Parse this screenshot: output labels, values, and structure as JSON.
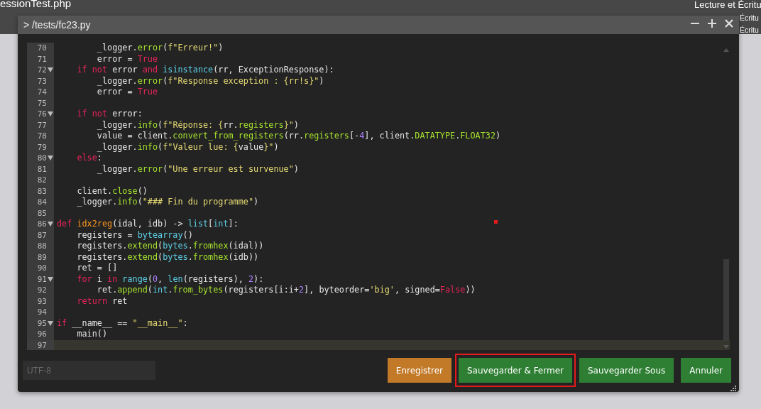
{
  "background": {
    "file_name": "essionTest.php",
    "right_texts": [
      "Lecture et Écritu",
      "Écritu",
      "Écritu"
    ]
  },
  "window": {
    "title": "> /tests/fc23.py",
    "controls": [
      {
        "kind": "minimize"
      },
      {
        "kind": "maximize"
      },
      {
        "kind": "close"
      }
    ]
  },
  "editor": {
    "lines": [
      {
        "number": "70",
        "current": false,
        "tokens": [
          {
            "text": "        _logger.",
            "kind": "plain"
          },
          {
            "text": "error",
            "kind": "call"
          },
          {
            "text": "(",
            "kind": "plain"
          },
          {
            "text": "f\"Erreur!\"",
            "kind": "string"
          },
          {
            "text": ")",
            "kind": "plain"
          }
        ]
      },
      {
        "number": "71",
        "current": false,
        "tokens": [
          {
            "text": "        error = ",
            "kind": "plain"
          },
          {
            "text": "True",
            "kind": "keyword"
          }
        ]
      },
      {
        "number": "72",
        "current": false,
        "expanded": true,
        "tokens": [
          {
            "text": "    if",
            "kind": "keyword"
          },
          {
            "text": " not",
            "kind": "keyword"
          },
          {
            "text": " error ",
            "kind": "plain"
          },
          {
            "text": "and",
            "kind": "keyword"
          },
          {
            "text": " isinstance",
            "kind": "builtin"
          },
          {
            "text": "(rr, ExceptionResponse):",
            "kind": "plain"
          }
        ]
      },
      {
        "number": "73",
        "current": false,
        "tokens": [
          {
            "text": "        _logger.",
            "kind": "plain"
          },
          {
            "text": "error",
            "kind": "call"
          },
          {
            "text": "(",
            "kind": "plain"
          },
          {
            "text": "f\"Response exception : {rr!s}\"",
            "kind": "string"
          },
          {
            "text": ")",
            "kind": "plain"
          }
        ]
      },
      {
        "number": "74",
        "current": false,
        "tokens": [
          {
            "text": "        error = ",
            "kind": "plain"
          },
          {
            "text": "True",
            "kind": "keyword"
          }
        ]
      },
      {
        "number": "75",
        "current": false
      },
      {
        "number": "76",
        "current": false,
        "expanded": true,
        "tokens": [
          {
            "text": "    if",
            "kind": "keyword"
          },
          {
            "text": " not",
            "kind": "keyword"
          },
          {
            "text": " error:",
            "kind": "plain"
          }
        ]
      },
      {
        "number": "77",
        "current": false,
        "tokens": [
          {
            "text": "        _logger.",
            "kind": "plain"
          },
          {
            "text": "info",
            "kind": "call"
          },
          {
            "text": "(",
            "kind": "plain"
          },
          {
            "text": "f\"Réponse: {",
            "kind": "string"
          },
          {
            "text": "rr.",
            "kind": "plain"
          },
          {
            "text": "registers",
            "kind": "call"
          },
          {
            "text": "}\"",
            "kind": "string"
          },
          {
            "text": ")",
            "kind": "plain"
          }
        ]
      },
      {
        "number": "78",
        "current": false,
        "tokens": [
          {
            "text": "        value = client.",
            "kind": "plain"
          },
          {
            "text": "convert_from_registers",
            "kind": "call"
          },
          {
            "text": "(rr.",
            "kind": "plain"
          },
          {
            "text": "registers",
            "kind": "call"
          },
          {
            "text": "[-",
            "kind": "plain"
          },
          {
            "text": "4",
            "kind": "number"
          },
          {
            "text": "], client.",
            "kind": "plain"
          },
          {
            "text": "DATATYPE",
            "kind": "call"
          },
          {
            "text": ".",
            "kind": "plain"
          },
          {
            "text": "FLOAT32",
            "kind": "call"
          },
          {
            "text": ")",
            "kind": "plain"
          }
        ]
      },
      {
        "number": "79",
        "current": false,
        "tokens": [
          {
            "text": "        _logger.",
            "kind": "plain"
          },
          {
            "text": "info",
            "kind": "call"
          },
          {
            "text": "(",
            "kind": "plain"
          },
          {
            "text": "f\"Valeur lue: {",
            "kind": "string"
          },
          {
            "text": "value",
            "kind": "plain"
          },
          {
            "text": "}\"",
            "kind": "string"
          },
          {
            "text": ")",
            "kind": "plain"
          }
        ]
      },
      {
        "number": "80",
        "current": false,
        "expanded": true,
        "tokens": [
          {
            "text": "    else",
            "kind": "keyword"
          },
          {
            "text": ":",
            "kind": "plain"
          }
        ]
      },
      {
        "number": "81",
        "current": false,
        "tokens": [
          {
            "text": "        _logger.",
            "kind": "plain"
          },
          {
            "text": "error",
            "kind": "call"
          },
          {
            "text": "(",
            "kind": "plain"
          },
          {
            "text": "\"Une erreur est survenue\"",
            "kind": "string"
          },
          {
            "text": ")",
            "kind": "plain"
          }
        ]
      },
      {
        "number": "82",
        "current": false
      },
      {
        "number": "83",
        "current": false,
        "tokens": [
          {
            "text": "    client.",
            "kind": "plain"
          },
          {
            "text": "close",
            "kind": "call"
          },
          {
            "text": "()",
            "kind": "plain"
          }
        ]
      },
      {
        "number": "84",
        "current": false,
        "tokens": [
          {
            "text": "    _logger.",
            "kind": "plain"
          },
          {
            "text": "info",
            "kind": "call"
          },
          {
            "text": "(",
            "kind": "plain"
          },
          {
            "text": "\"### Fin du programme\"",
            "kind": "string"
          },
          {
            "text": ")",
            "kind": "plain"
          }
        ]
      },
      {
        "number": "85",
        "current": false
      },
      {
        "number": "86",
        "current": false,
        "expanded": true,
        "tokens": [
          {
            "text": "def",
            "kind": "keyword"
          },
          {
            "text": " idx2reg",
            "kind": "funcname"
          },
          {
            "text": "(idal, idb) -> ",
            "kind": "plain"
          },
          {
            "text": "list",
            "kind": "builtin"
          },
          {
            "text": "[",
            "kind": "plain"
          },
          {
            "text": "int",
            "kind": "builtin"
          },
          {
            "text": "]:",
            "kind": "plain"
          }
        ]
      },
      {
        "number": "87",
        "current": false,
        "tokens": [
          {
            "text": "    registers = ",
            "kind": "plain"
          },
          {
            "text": "bytearray",
            "kind": "builtin"
          },
          {
            "text": "()",
            "kind": "plain"
          }
        ]
      },
      {
        "number": "88",
        "current": false,
        "tokens": [
          {
            "text": "    registers.",
            "kind": "plain"
          },
          {
            "text": "extend",
            "kind": "call"
          },
          {
            "text": "(",
            "kind": "plain"
          },
          {
            "text": "bytes",
            "kind": "builtin"
          },
          {
            "text": ".",
            "kind": "plain"
          },
          {
            "text": "fromhex",
            "kind": "call"
          },
          {
            "text": "(idal))",
            "kind": "plain"
          }
        ]
      },
      {
        "number": "89",
        "current": false,
        "tokens": [
          {
            "text": "    registers.",
            "kind": "plain"
          },
          {
            "text": "extend",
            "kind": "call"
          },
          {
            "text": "(",
            "kind": "plain"
          },
          {
            "text": "bytes",
            "kind": "builtin"
          },
          {
            "text": ".",
            "kind": "plain"
          },
          {
            "text": "fromhex",
            "kind": "call"
          },
          {
            "text": "(idb))",
            "kind": "plain"
          }
        ]
      },
      {
        "number": "90",
        "current": false,
        "tokens": [
          {
            "text": "    ret = []",
            "kind": "plain"
          }
        ]
      },
      {
        "number": "91",
        "current": false,
        "expanded": true,
        "tokens": [
          {
            "text": "    for",
            "kind": "keyword"
          },
          {
            "text": " i ",
            "kind": "plain"
          },
          {
            "text": "in",
            "kind": "keyword"
          },
          {
            "text": " range",
            "kind": "builtin"
          },
          {
            "text": "(",
            "kind": "plain"
          },
          {
            "text": "0",
            "kind": "number"
          },
          {
            "text": ", ",
            "kind": "plain"
          },
          {
            "text": "len",
            "kind": "builtin"
          },
          {
            "text": "(registers), ",
            "kind": "plain"
          },
          {
            "text": "2",
            "kind": "number"
          },
          {
            "text": "):",
            "kind": "plain"
          }
        ]
      },
      {
        "number": "92",
        "current": false,
        "tokens": [
          {
            "text": "        ret.",
            "kind": "plain"
          },
          {
            "text": "append",
            "kind": "call"
          },
          {
            "text": "(",
            "kind": "plain"
          },
          {
            "text": "int",
            "kind": "builtin"
          },
          {
            "text": ".",
            "kind": "plain"
          },
          {
            "text": "from_bytes",
            "kind": "call"
          },
          {
            "text": "(registers[i:i+",
            "kind": "plain"
          },
          {
            "text": "2",
            "kind": "number"
          },
          {
            "text": "], byteorder=",
            "kind": "plain"
          },
          {
            "text": "'big'",
            "kind": "string"
          },
          {
            "text": ", signed=",
            "kind": "plain"
          },
          {
            "text": "False",
            "kind": "keyword"
          },
          {
            "text": "))",
            "kind": "plain"
          }
        ]
      },
      {
        "number": "93",
        "current": false,
        "tokens": [
          {
            "text": "    return",
            "kind": "keyword"
          },
          {
            "text": " ret",
            "kind": "plain"
          }
        ]
      },
      {
        "number": "94",
        "current": false
      },
      {
        "number": "95",
        "current": false,
        "expanded": true,
        "tokens": [
          {
            "text": "if",
            "kind": "keyword"
          },
          {
            "text": " __name__ == ",
            "kind": "plain"
          },
          {
            "text": "\"__main__\"",
            "kind": "string"
          },
          {
            "text": ":",
            "kind": "plain"
          }
        ]
      },
      {
        "number": "96",
        "current": false,
        "tokens": [
          {
            "text": "    main()",
            "kind": "plain"
          }
        ]
      },
      {
        "number": "97",
        "current": true
      }
    ]
  },
  "footer": {
    "encoding_field": {
      "placeholder": "UTF-8"
    },
    "buttons": [
      {
        "label": "Enregistrer",
        "kind": "save",
        "highlighted": false
      },
      {
        "label": "Sauvegarder & Fermer",
        "kind": "primary",
        "highlighted": true
      },
      {
        "label": "Sauvegarder Sous",
        "kind": "primary",
        "highlighted": false
      },
      {
        "label": "Annuler",
        "kind": "primary",
        "highlighted": false
      }
    ]
  }
}
